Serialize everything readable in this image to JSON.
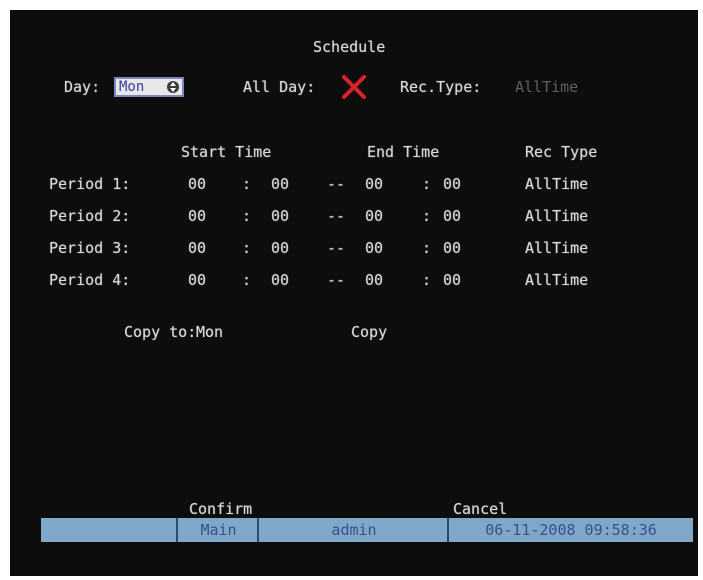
{
  "title": "Schedule",
  "day_label": "Day:",
  "day_value": "Mon",
  "all_day_label": "All Day:",
  "all_day_checked": false,
  "rec_type_label": "Rec.Type:",
  "rec_type_value": "AllTime",
  "columns": {
    "start_time": "Start Time",
    "end_time": "End Time",
    "rec_type": "Rec Type"
  },
  "periods": [
    {
      "label": "Period 1:",
      "start_h": "00",
      "start_m": "00",
      "end_h": "00",
      "end_m": "00",
      "type": "AllTime"
    },
    {
      "label": "Period 2:",
      "start_h": "00",
      "start_m": "00",
      "end_h": "00",
      "end_m": "00",
      "type": "AllTime"
    },
    {
      "label": "Period 3:",
      "start_h": "00",
      "start_m": "00",
      "end_h": "00",
      "end_m": "00",
      "type": "AllTime"
    },
    {
      "label": "Period 4:",
      "start_h": "00",
      "start_m": "00",
      "end_h": "00",
      "end_m": "00",
      "type": "AllTime"
    }
  ],
  "time_colon": ":",
  "range_dash": "--",
  "copy_to_label": "Copy to:",
  "copy_to_value": "Mon",
  "copy_button": "Copy",
  "confirm_button": "Confirm",
  "cancel_button": "Cancel",
  "status": {
    "menu": "Main",
    "user": "admin",
    "datetime": "06-11-2008 09:58:36"
  },
  "colors": {
    "background": "#0d0d0d",
    "text": "#d9d9d9",
    "disabled_text": "#5e5e5e",
    "statusbar": "#7fa7c9",
    "x_mark": "#d8232a"
  },
  "icons": {
    "all_day_checkbox": "red-x-icon",
    "day_spinner": "up-down-arrow-icon"
  }
}
